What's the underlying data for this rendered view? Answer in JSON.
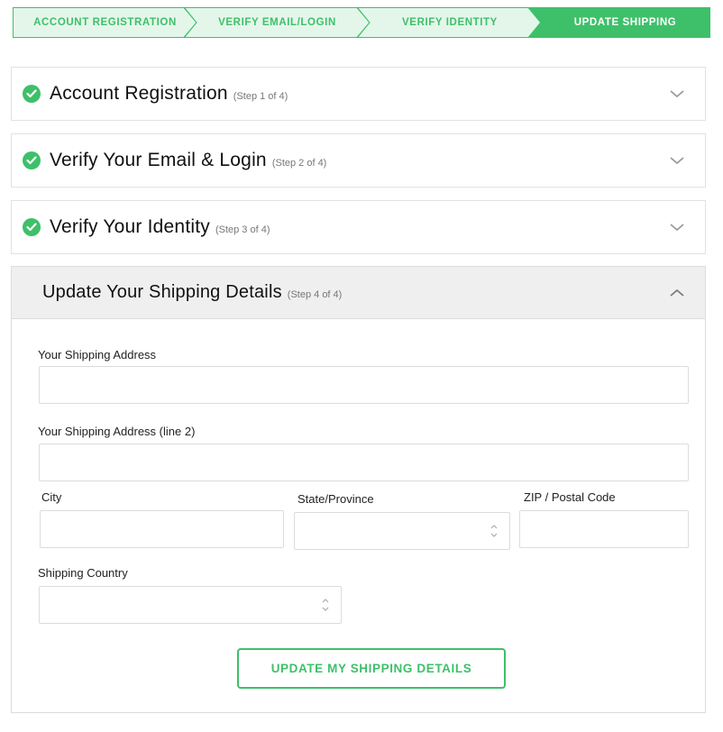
{
  "colors": {
    "accent": "#3ec06a",
    "done_step_bg": "#e4f6ea",
    "panel_head_bg": "#efefef"
  },
  "stepper": {
    "steps": [
      {
        "label": "ACCOUNT REGISTRATION",
        "state": "done"
      },
      {
        "label": "VERIFY EMAIL/LOGIN",
        "state": "done"
      },
      {
        "label": "VERIFY IDENTITY",
        "state": "done"
      },
      {
        "label": "UPDATE SHIPPING",
        "state": "active"
      }
    ]
  },
  "panels": [
    {
      "title": "Account Registration",
      "step": "(Step 1 of 4)",
      "status": "complete",
      "icon": "check-icon"
    },
    {
      "title": "Verify Your Email & Login",
      "step": "(Step 2 of 4)",
      "status": "complete",
      "icon": "check-icon"
    },
    {
      "title": "Verify Your Identity",
      "step": "(Step 3 of 4)",
      "status": "complete",
      "icon": "check-icon"
    },
    {
      "title": "Update Your Shipping Details",
      "step": "(Step 4 of 4)",
      "status": "open"
    }
  ],
  "form": {
    "address_label": "Your Shipping Address",
    "address_value": "",
    "address2_label": "Your Shipping Address (line 2)",
    "address2_value": "",
    "city_label": "City",
    "city_value": "",
    "state_label": "State/Province",
    "state_value": "",
    "zip_label": "ZIP / Postal Code",
    "zip_value": "",
    "country_label": "Shipping Country",
    "country_value": "",
    "submit_label": "UPDATE MY SHIPPING DETAILS"
  }
}
